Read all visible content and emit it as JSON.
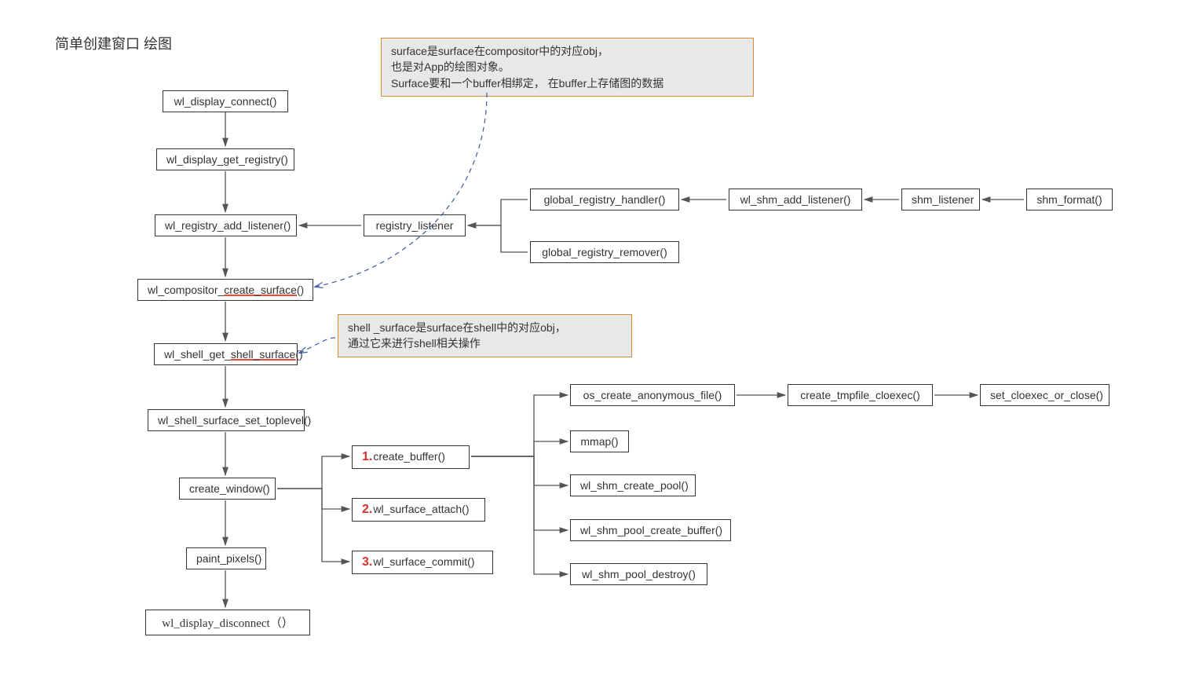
{
  "title": "简单创建窗口 绘图",
  "notes": {
    "surface": "surface是surface在compositor中的对应obj，\n也是对App的绘图对象。\nSurface要和一个buffer相绑定， 在buffer上存储图的数据",
    "shell": "shell _surface是surface在shell中的对应obj，\n通过它来进行shell相关操作"
  },
  "nodes": {
    "connect": "wl_display_connect()",
    "get_registry": "wl_display_get_registry()",
    "add_listener": "wl_registry_add_listener()",
    "registry_listener": "registry_listener",
    "global_handler": "global_registry_handler()",
    "global_remover": "global_registry_remover()",
    "shm_add_listener": "wl_shm_add_listener()",
    "shm_listener": "shm_listener",
    "shm_format": "shm_format()",
    "comp_create_surface_a": "wl_compositor_",
    "comp_create_surface_b": "create_surface()",
    "shell_get_surface_a": "wl_shell_get_",
    "shell_get_surface_b": "shell_surface()",
    "set_toplevel": "wl_shell_surface_set_toplevel()",
    "create_window": "create_window()",
    "paint_pixels": "paint_pixels()",
    "disconnect": "wl_display_disconnect（）",
    "create_buffer": "create_buffer()",
    "surface_attach": "wl_surface_attach()",
    "surface_commit": "wl_surface_commit()",
    "os_create_anon": "os_create_anonymous_file()",
    "mmap": "mmap()",
    "shm_create_pool": "wl_shm_create_pool()",
    "shm_pool_create_buf": "wl_shm_pool_create_buffer()",
    "shm_pool_destroy": "wl_shm_pool_destroy()",
    "create_tmpfile": "create_tmpfile_cloexec()",
    "set_cloexec": "set_cloexec_or_close()",
    "n1": "1.",
    "n2": "2.",
    "n3": "3."
  }
}
